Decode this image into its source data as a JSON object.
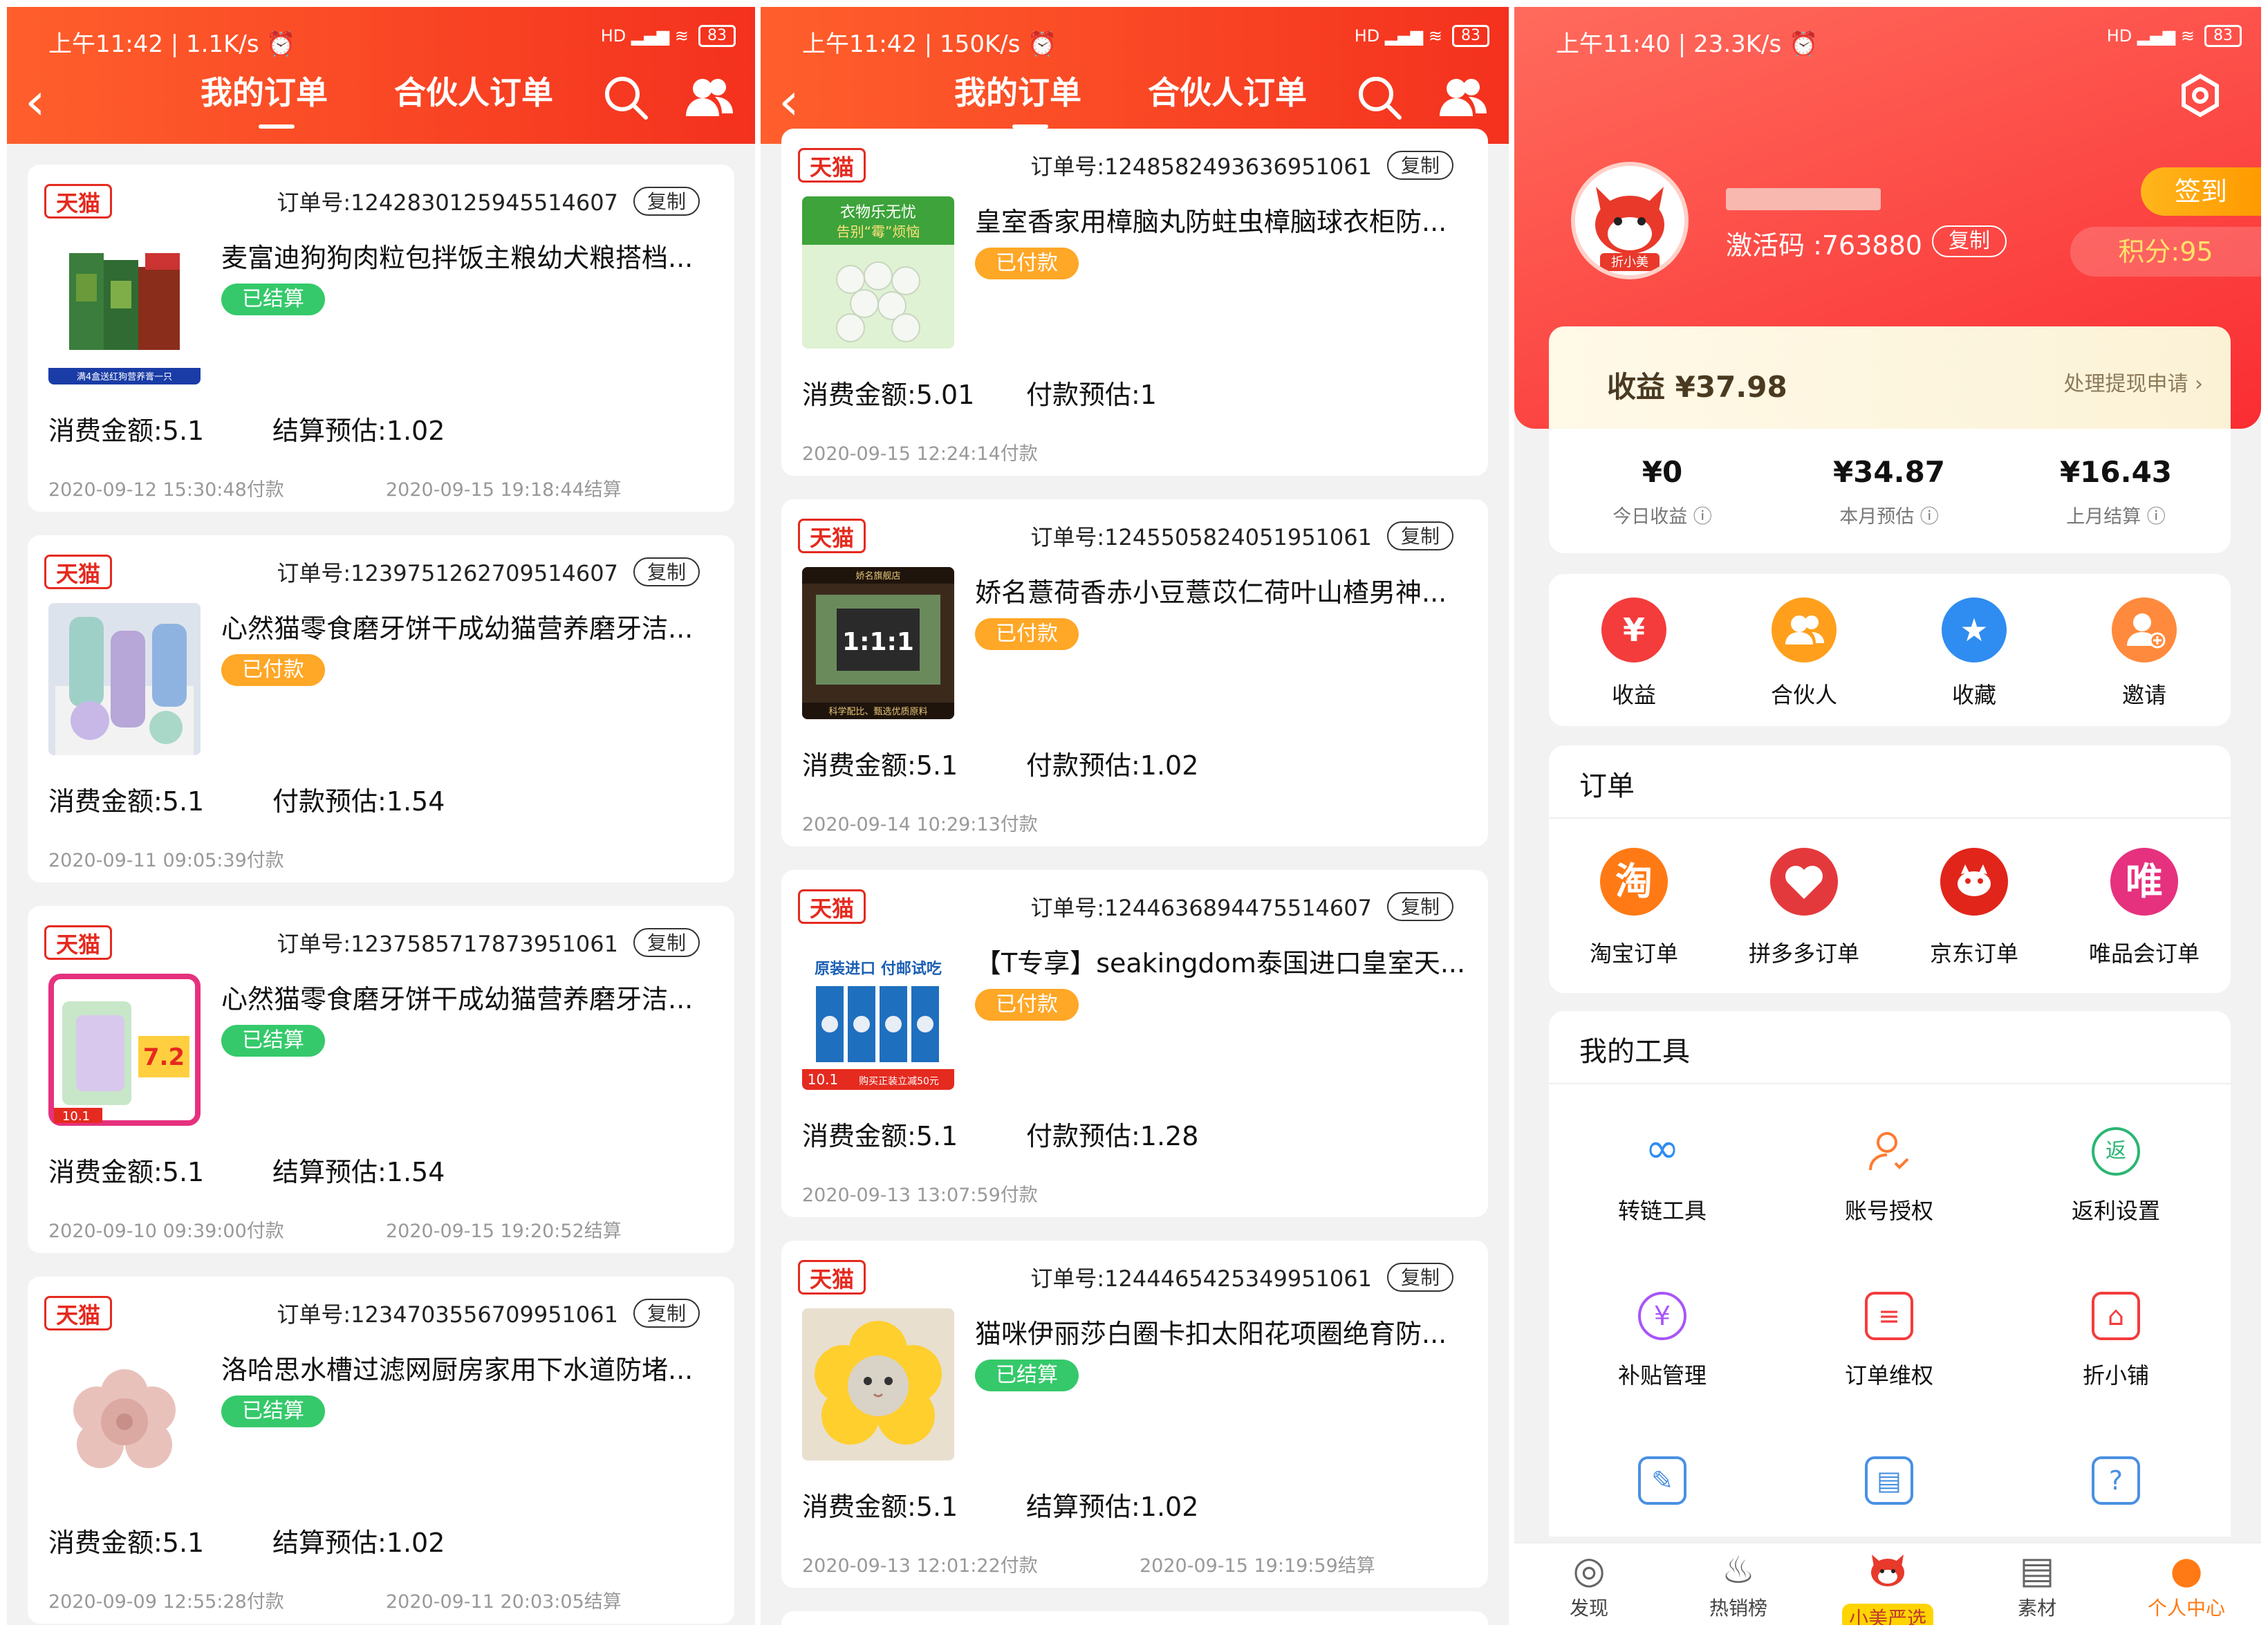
{
  "colors": {
    "accent": "#f4311e",
    "paid": "#ffa726",
    "settled": "#35c96b",
    "tmall": "#e52a1f"
  },
  "panels": [
    {
      "status_time": "上午11:42 | 1.1K/s ⏰",
      "status_right": "HD ▂▄▆ ≋",
      "battery": "83",
      "tabs": [
        "我的订单",
        "合伙人订单"
      ],
      "icons": {
        "back": "back-chevron-icon",
        "search": "search-icon",
        "partners": "partners-icon"
      },
      "orders": [
        {
          "platform": "天猫",
          "order_no": "订单号:1242830125945514607",
          "copy": "复制",
          "title": "麦富迪狗狗肉粒包拌饭主粮幼犬粮搭档...",
          "status": "已结算",
          "amount": "消费金额:5.1",
          "estimate": "结算预估:1.02",
          "time_paid": "2020-09-12 15:30:48付款",
          "time_settled": "2020-09-15 19:18:44结算"
        },
        {
          "platform": "天猫",
          "order_no": "订单号:1239751262709514607",
          "copy": "复制",
          "title": "心然猫零食磨牙饼干成幼猫营养磨牙洁...",
          "status": "已付款",
          "amount": "消费金额:5.1",
          "estimate": "付款预估:1.54",
          "time_paid": "2020-09-11 09:05:39付款",
          "time_settled": ""
        },
        {
          "platform": "天猫",
          "order_no": "订单号:1237585717873951061",
          "copy": "复制",
          "title": "心然猫零食磨牙饼干成幼猫营养磨牙洁...",
          "status": "已结算",
          "amount": "消费金额:5.1",
          "estimate": "结算预估:1.54",
          "time_paid": "2020-09-10 09:39:00付款",
          "time_settled": "2020-09-15 19:20:52结算"
        },
        {
          "platform": "天猫",
          "order_no": "订单号:1234703556709951061",
          "copy": "复制",
          "title": "洛哈思水槽过滤网厨房家用下水道防堵...",
          "status": "已结算",
          "amount": "消费金额:5.1",
          "estimate": "结算预估:1.02",
          "time_paid": "2020-09-09 12:55:28付款",
          "time_settled": "2020-09-11 20:03:05结算"
        }
      ]
    },
    {
      "status_time": "上午11:42 | 150K/s ⏰",
      "status_right": "HD ▂▄▆ ≋",
      "battery": "83",
      "tabs": [
        "我的订单",
        "合伙人订单"
      ],
      "orders": [
        {
          "platform": "天猫",
          "order_no": "订单号:1248582493636951061",
          "copy": "复制",
          "title": "皇室香家用樟脑丸防蛀虫樟脑球衣柜防...",
          "status": "已付款",
          "amount": "消费金额:5.01",
          "estimate": "付款预估:1",
          "time_paid": "2020-09-15 12:24:14付款",
          "time_settled": ""
        },
        {
          "platform": "天猫",
          "order_no": "订单号:1245505824051951061",
          "copy": "复制",
          "title": "娇名薏荷香赤小豆薏苡仁荷叶山楂男神...",
          "status": "已付款",
          "amount": "消费金额:5.1",
          "estimate": "付款预估:1.02",
          "time_paid": "2020-09-14 10:29:13付款",
          "time_settled": ""
        },
        {
          "platform": "天猫",
          "order_no": "订单号:1244636894475514607",
          "copy": "复制",
          "title": "【T专享】seakingdom泰国进口皇室天...",
          "status": "已付款",
          "amount": "消费金额:5.1",
          "estimate": "付款预估:1.28",
          "time_paid": "2020-09-13 13:07:59付款",
          "time_settled": ""
        },
        {
          "platform": "天猫",
          "order_no": "订单号:1244465425349951061",
          "copy": "复制",
          "title": "猫咪伊丽莎白圈卡扣太阳花项圈绝育防...",
          "status": "已结算",
          "amount": "消费金额:5.1",
          "estimate": "结算预估:1.02",
          "time_paid": "2020-09-13 12:01:22付款",
          "time_settled": "2020-09-15 19:19:59结算"
        }
      ]
    }
  ],
  "thumb_text": {
    "dogfood": "满4盒送红狗营养膏一只",
    "mothball1": "衣物乐无忧",
    "mothball2": "告别“霉”烦恼",
    "tea_shop": "娇名旗舰店",
    "tea_footer": "科学配比、甄选优质原料",
    "cat_promo": "原装进口 付邮试吃",
    "cat_price": "10.1",
    "cat_coupon": "购买正装立减50元",
    "cat_treat_price": "10.1"
  },
  "profile": {
    "status_time": "上午11:40 | 23.3K/s ⏰",
    "battery": "83",
    "avatar_label": "折小美",
    "activation_code": "激活码 :763880",
    "copy": "复制",
    "signin": "签到",
    "points": "积分:95",
    "earnings_label": "收益 ¥37.98",
    "withdraw": "处理提现申请 ›",
    "stats": [
      {
        "value": "¥0",
        "label": "今日收益 ⓘ"
      },
      {
        "value": "¥34.87",
        "label": "本月预估 ⓘ"
      },
      {
        "value": "¥16.43",
        "label": "上月结算 ⓘ"
      }
    ],
    "quick": [
      {
        "label": "收益",
        "glyph": "¥",
        "color": "#f43c3c",
        "icon": "earnings-bag-icon"
      },
      {
        "label": "合伙人",
        "glyph": "👥",
        "color": "#ff9f1c",
        "icon": "partner-icon"
      },
      {
        "label": "收藏",
        "glyph": "★",
        "color": "#2f8cf0",
        "icon": "star-icon"
      },
      {
        "label": "邀请",
        "glyph": "+",
        "color": "#ff8a3d",
        "icon": "invite-user-icon"
      }
    ],
    "orders_title": "订单",
    "orders": [
      {
        "label": "淘宝订单",
        "glyph": "淘",
        "color": "#ff7a14",
        "icon": "taobao-icon"
      },
      {
        "label": "拼多多订单",
        "glyph": "拼",
        "color": "#e4393c",
        "icon": "pinduoduo-icon"
      },
      {
        "label": "京东订单",
        "glyph": "JD",
        "color": "#e1251b",
        "icon": "jd-icon"
      },
      {
        "label": "唯品会订单",
        "glyph": "唯",
        "color": "#e6317e",
        "icon": "vipshop-icon"
      }
    ],
    "tools_title": "我的工具",
    "tools": [
      {
        "label": "转链工具",
        "glyph": "∞",
        "color": "#2f8cf0",
        "icon": "link-icon"
      },
      {
        "label": "账号授权",
        "glyph": "✓",
        "color": "#ff7a2f",
        "icon": "account-auth-icon"
      },
      {
        "label": "返利设置",
        "glyph": "返",
        "color": "#2bb673",
        "icon": "rebate-icon"
      },
      {
        "label": "补贴管理",
        "glyph": "¥",
        "color": "#a855f7",
        "icon": "subsidy-icon"
      },
      {
        "label": "订单维权",
        "glyph": "≡",
        "color": "#f43c3c",
        "icon": "order-rights-icon"
      },
      {
        "label": "折小铺",
        "glyph": "⌂",
        "color": "#f43c3c",
        "icon": "shop-icon"
      },
      {
        "label": "",
        "glyph": "✎",
        "color": "#2f8cf0",
        "icon": "edit-icon"
      },
      {
        "label": "",
        "glyph": "▤",
        "color": "#2f8cf0",
        "icon": "book-icon"
      },
      {
        "label": "",
        "glyph": "?",
        "color": "#2f8cf0",
        "icon": "help-icon"
      }
    ],
    "nav": [
      {
        "label": "发现",
        "glyph": "◎",
        "icon": "discover-icon"
      },
      {
        "label": "热销榜",
        "glyph": "♨",
        "icon": "hot-list-icon"
      },
      {
        "label": "小美严选",
        "glyph": "",
        "icon": "mascot-icon"
      },
      {
        "label": "素材",
        "glyph": "▤",
        "icon": "materials-icon"
      },
      {
        "label": "个人中心",
        "glyph": "●",
        "icon": "profile-icon"
      }
    ]
  }
}
